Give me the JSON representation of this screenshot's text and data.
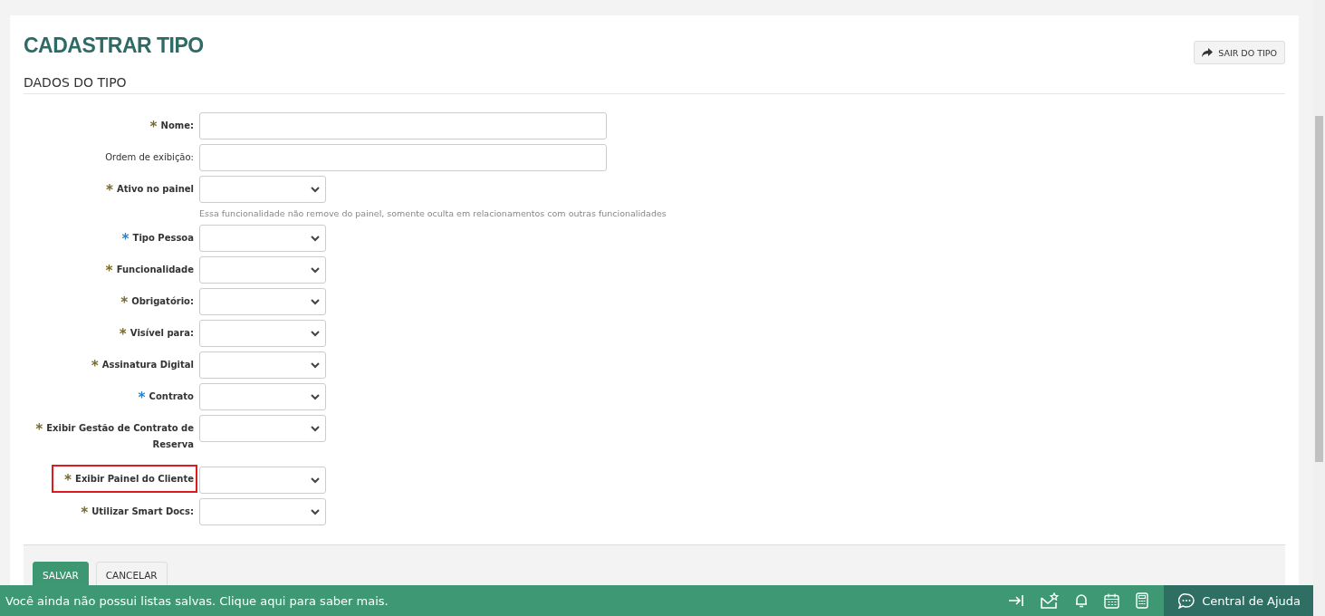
{
  "title": "CADASTRAR TIPO",
  "exit_button": {
    "label": "SAIR DO TIPO"
  },
  "section_title": "DADOS DO TIPO",
  "fields": [
    {
      "marker": "*",
      "color": "#7a6a2a",
      "label": "Nome:",
      "kind": "text",
      "highlighted": false
    },
    {
      "label": "Ordem de exibição:",
      "kind": "text",
      "highlighted": false
    },
    {
      "marker": "*",
      "color": "#7a6a2a",
      "label": "Ativo no painel",
      "kind": "select",
      "highlighted": false,
      "hint": "Essa funcionalidade não remove do painel, somente oculta em relacionamentos com outras funcionalidades"
    },
    {
      "marker": "*",
      "color": "#2f7fc1",
      "label": "Tipo Pessoa",
      "kind": "select",
      "highlighted": false
    },
    {
      "marker": "*",
      "color": "#7a6a2a",
      "label": "Funcionalidade",
      "kind": "select",
      "highlighted": false
    },
    {
      "marker": "*",
      "color": "#7a6a2a",
      "label": "Obrigatório:",
      "kind": "select",
      "highlighted": false
    },
    {
      "marker": "*",
      "color": "#7a6a2a",
      "label": "Visível para:",
      "kind": "select",
      "highlighted": false
    },
    {
      "marker": "*",
      "color": "#7a6a2a",
      "label": "Assinatura Digital",
      "kind": "select",
      "highlighted": false
    },
    {
      "marker": "*",
      "color": "#2f7fc1",
      "label": "Contrato",
      "kind": "select",
      "highlighted": false
    },
    {
      "marker": "*",
      "color": "#7a6a2a",
      "label": "Exibir Gestão de Contrato de Reserva",
      "kind": "select",
      "highlighted": false
    },
    {
      "marker": "*",
      "color": "#7a6a2a",
      "label": "Exibir Painel do Cliente",
      "kind": "select",
      "highlighted": true
    },
    {
      "marker": "*",
      "color": "#7a6a2a",
      "label": "Utilizar Smart Docs:",
      "kind": "select",
      "highlighted": false
    }
  ],
  "actions": [
    {
      "label": "SALVAR",
      "kind": "primary"
    },
    {
      "label": "CANCELAR",
      "kind": "default"
    }
  ],
  "bottom_bar": {
    "message": "Você ainda não possui listas salvas. Clique aqui para saber mais.",
    "help_label": "Central de Ajuda"
  }
}
